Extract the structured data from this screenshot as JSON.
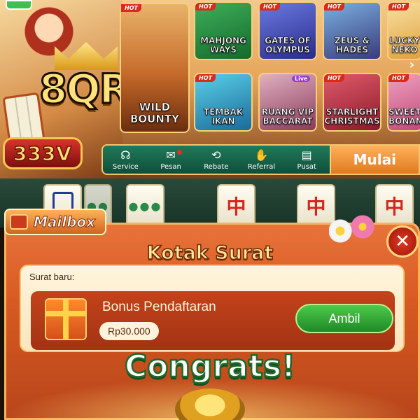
{
  "brand": {
    "logo_text": "8QR",
    "badge_text": "333V"
  },
  "lobby": {
    "featured_game": {
      "label": "WILD\nBOUNTY",
      "hot": "HOT"
    },
    "games": [
      {
        "label": "MAHJONG WAYS",
        "hot": "HOT"
      },
      {
        "label": "GATES OF OLYMPUS",
        "hot": "HOT"
      },
      {
        "label": "ZEUS & HADES",
        "hot": "HOT"
      },
      {
        "label": "LUCKY NEKO",
        "hot": "HOT"
      },
      {
        "label": "TEMBAK IKAN",
        "hot": "HOT"
      },
      {
        "label": "RUANG VIP BACCARAT",
        "hot": "",
        "live": "Live"
      },
      {
        "label": "STARLIGHT CHRISTMAS",
        "hot": "HOT"
      },
      {
        "label": "SWEET BONANZA",
        "hot": "HOT"
      }
    ],
    "nav": [
      {
        "label": "Service",
        "icon": "headset-icon"
      },
      {
        "label": "Pesan",
        "icon": "envelope-icon",
        "has_dot": true
      },
      {
        "label": "Rebate",
        "icon": "rebate-icon"
      },
      {
        "label": "Referral",
        "icon": "handshake-icon"
      },
      {
        "label": "Pusat",
        "icon": "clipboard-icon"
      }
    ],
    "start_label": "Mulai"
  },
  "tiles": {
    "glyph": "中"
  },
  "mailbox": {
    "tab_label": "Mailbox",
    "title": "Kotak Surat",
    "new_mail_label": "Surat baru:",
    "message": {
      "title": "Bonus Pendaftaran",
      "amount": "Rp30.000",
      "claim_label": "Ambil"
    },
    "congrats": "Congrats!"
  },
  "colors": {
    "panel_orange": "#d75a22",
    "claim_green": "#1f8a28",
    "nav_green": "#0f4e39",
    "gold": "#ffe27a"
  }
}
